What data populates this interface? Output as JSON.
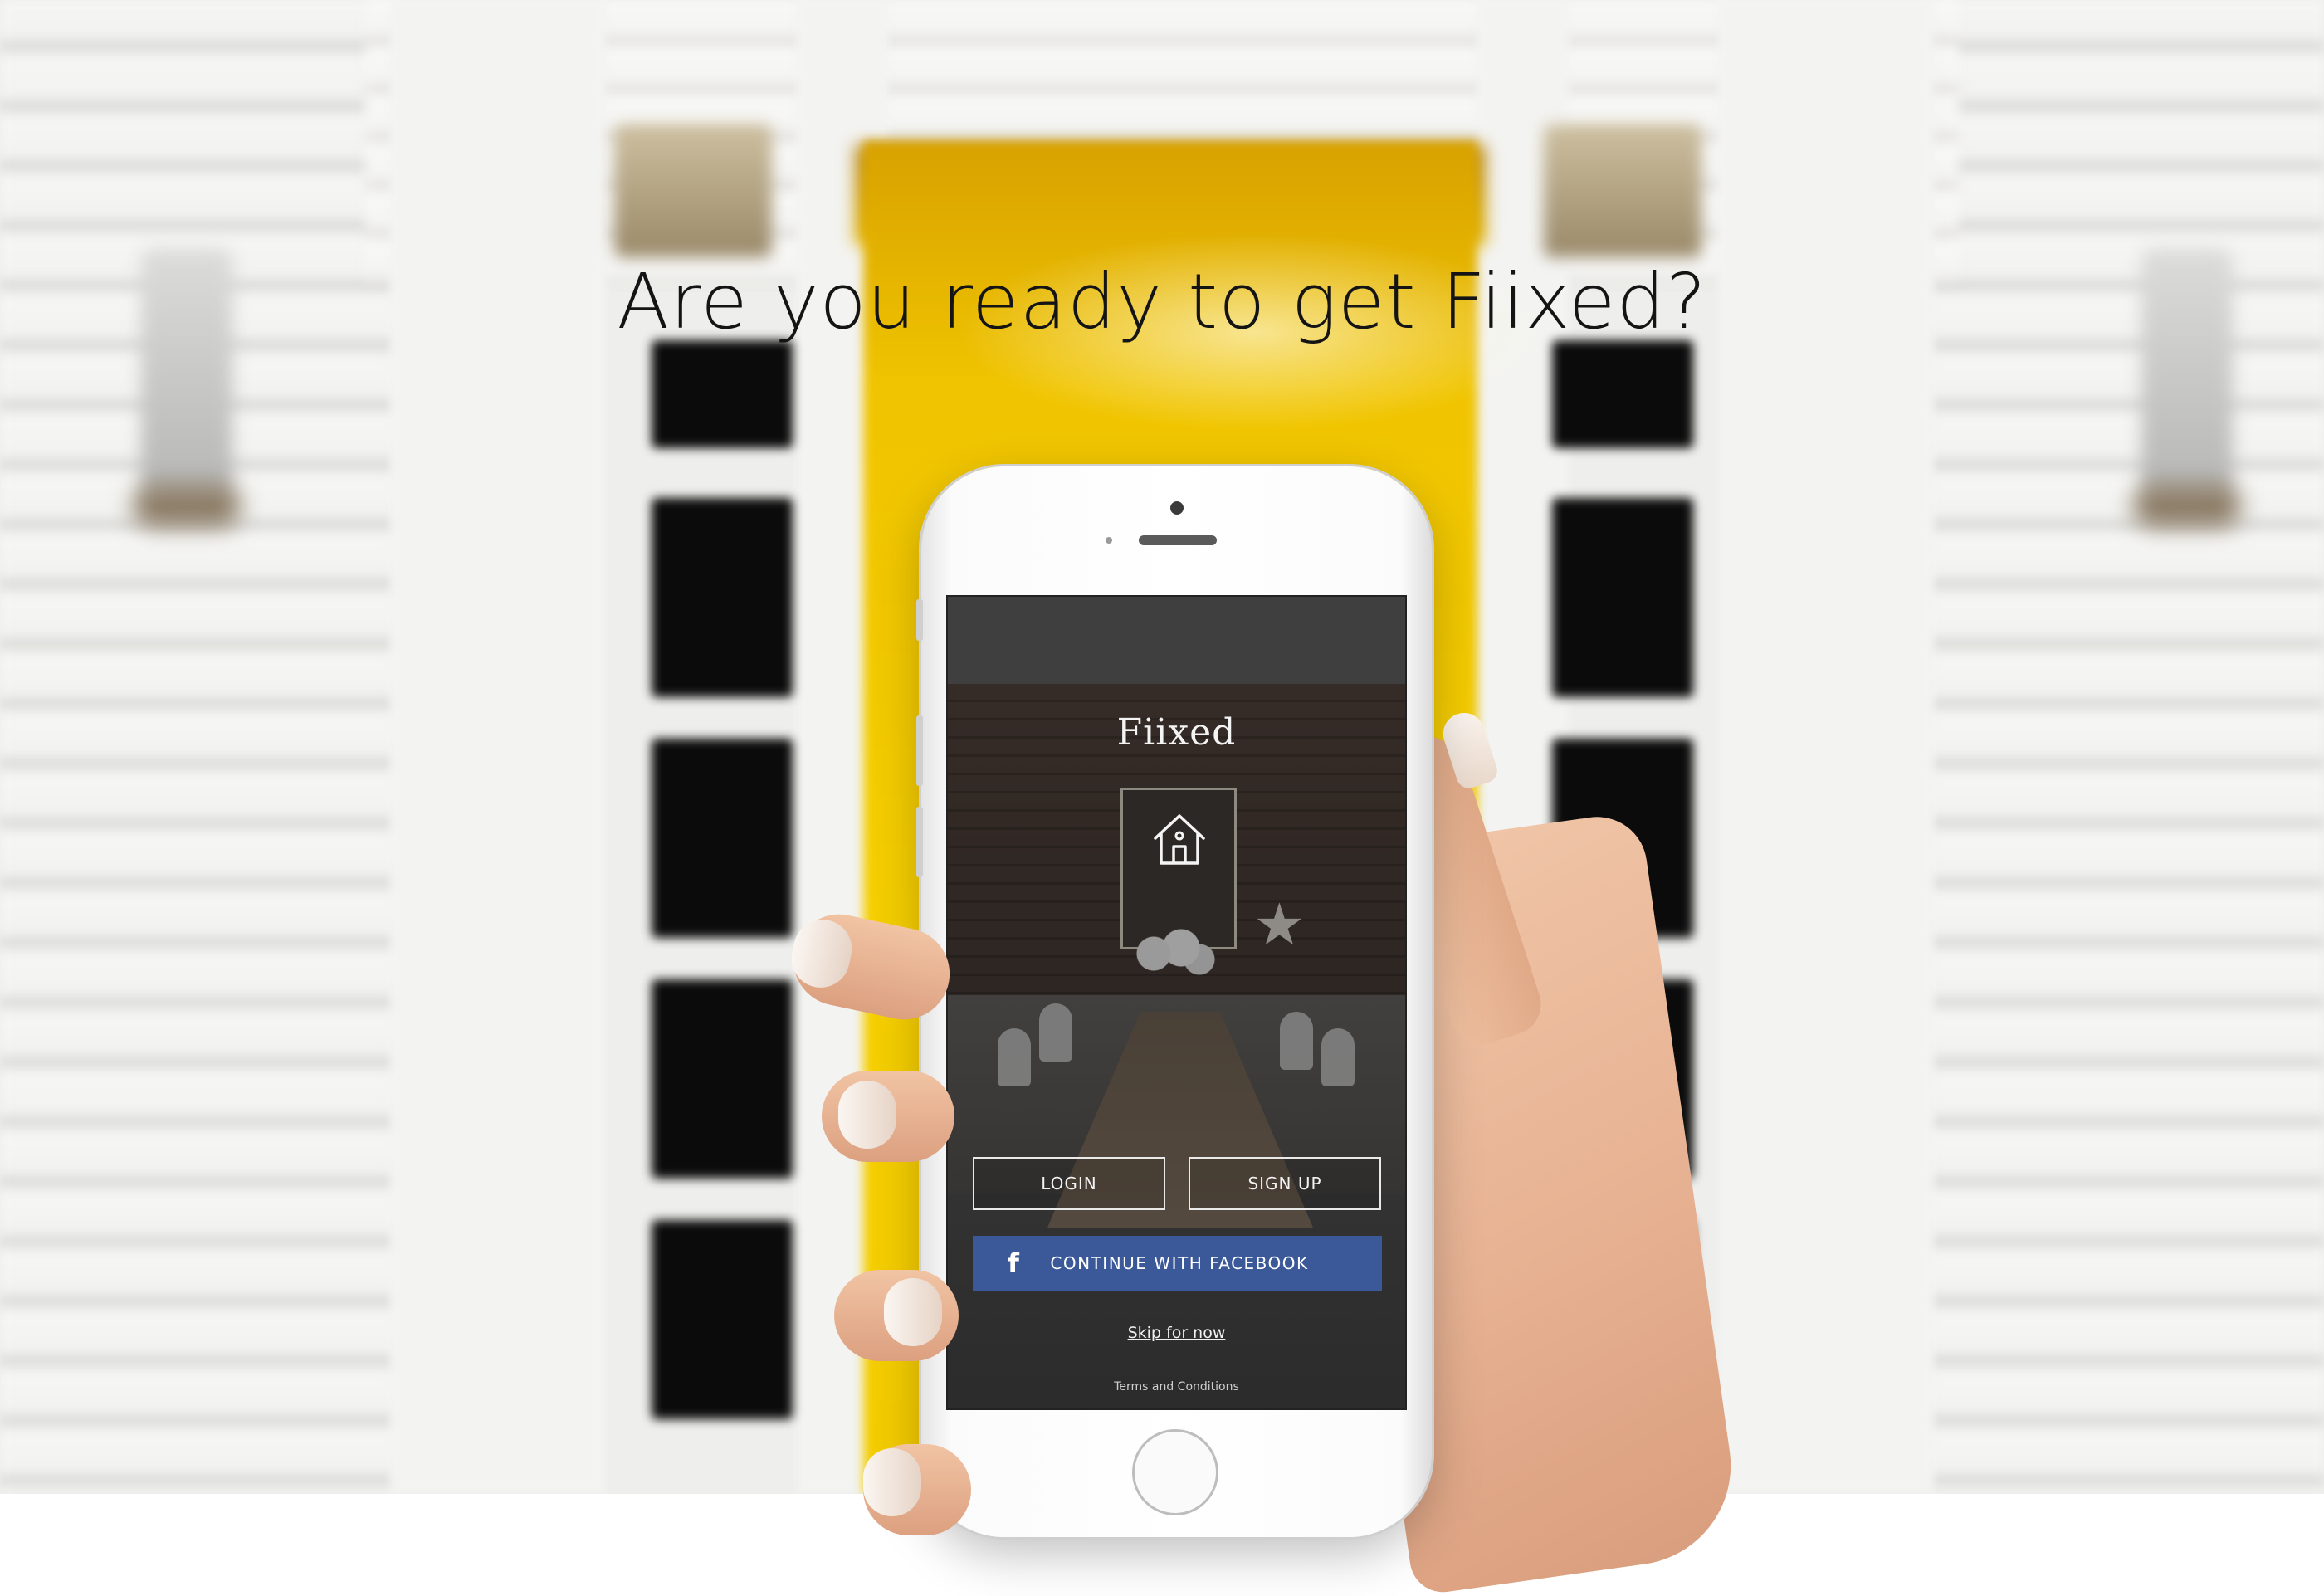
{
  "headline": "Are you ready to get Fiixed?",
  "app": {
    "logo": "Fiixed",
    "icons": {
      "logo_icon": "house-icon",
      "facebook_icon": "facebook-icon"
    },
    "login_label": "LOGIN",
    "signup_label": "SIGN UP",
    "facebook_label": "CONTINUE WITH FACEBOOK",
    "facebook_glyph": "f",
    "skip_label": "Skip for now",
    "terms_label": "Terms and Conditions"
  },
  "colors": {
    "door_yellow": "#f4cc00",
    "facebook_blue": "#3b5998",
    "headline_text": "#141414"
  }
}
